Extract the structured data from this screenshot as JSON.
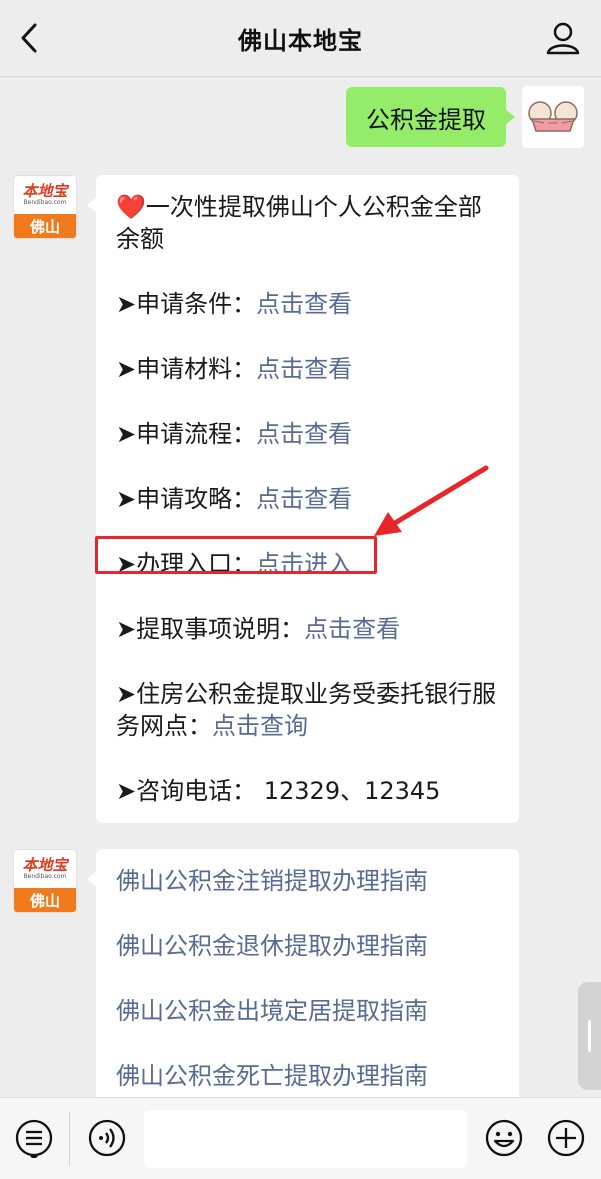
{
  "header": {
    "title": "佛山本地宝"
  },
  "messages": {
    "user_text": "公积金提取",
    "bot_avatar": {
      "brand": "本地宝",
      "url": "Bendibao.com",
      "city": "佛山"
    },
    "msg1": {
      "heading_prefix": "❤️",
      "heading": "一次性提取佛山个人公积金全部余额",
      "items": [
        {
          "arrow": "➤",
          "label": "申请条件：",
          "link": "点击查看"
        },
        {
          "arrow": "➤",
          "label": "申请材料：",
          "link": "点击查看"
        },
        {
          "arrow": "➤",
          "label": "申请流程：",
          "link": "点击查看"
        },
        {
          "arrow": "➤",
          "label": "申请攻略：",
          "link": "点击查看"
        },
        {
          "arrow": "➤",
          "label": "办理入口：",
          "link": "点击进入"
        },
        {
          "arrow": "➤",
          "label": "提取事项说明：",
          "link": "点击查看"
        }
      ],
      "bank_label": "➤住房公积金提取业务受委托银行服务网点：",
      "bank_link": "点击查询",
      "phone": "➤咨询电话：  12329、12345"
    },
    "msg2": {
      "links": [
        "佛山公积金注销提取办理指南",
        "佛山公积金退休提取办理指南",
        "佛山公积金出境定居提取指南",
        "佛山公积金死亡提取办理指南"
      ]
    }
  },
  "icons": {
    "back": "chevron-left-icon",
    "profile": "person-icon",
    "menu": "list-menu-icon",
    "voice": "voice-icon",
    "emoji": "emoji-icon",
    "plus": "plus-icon"
  },
  "colors": {
    "link": "#576b95",
    "user_bubble": "#95ec69",
    "highlight": "#e8262a",
    "brand_orange": "#f07a1c"
  }
}
